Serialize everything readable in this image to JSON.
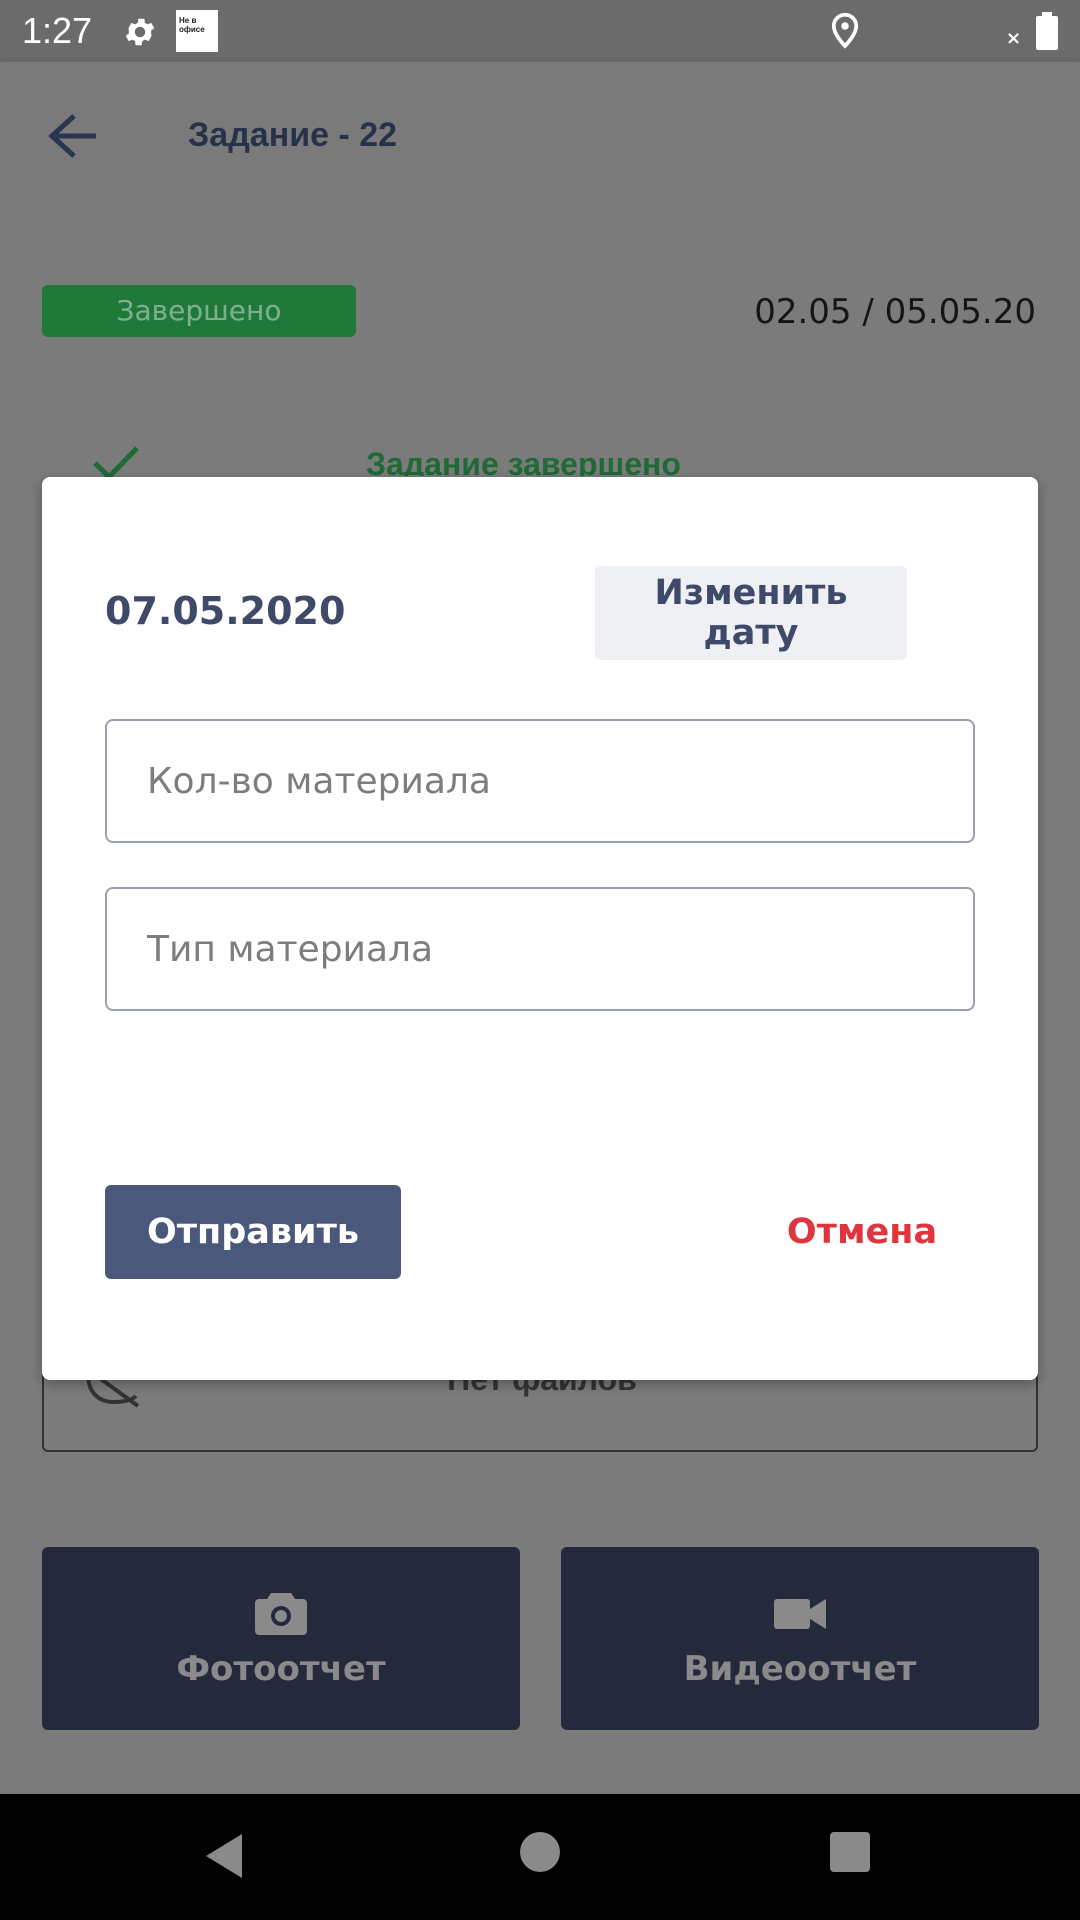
{
  "status_bar": {
    "time": "1:27",
    "office_badge": "Не в офисе"
  },
  "app_bar": {
    "title": "Задание - 22"
  },
  "task": {
    "status": "Завершено",
    "date_range": "02.05 / 05.05.20",
    "completed_label": "Задание завершено",
    "files_label": "Нет файлов"
  },
  "buttons": {
    "photo_report": "Фотоотчет",
    "video_report": "Видеоотчет"
  },
  "dialog": {
    "date": "07.05.2020",
    "change_date_label": "Изменить дату",
    "qty_placeholder": "Кол-во материала",
    "type_placeholder": "Тип материала",
    "submit_label": "Отправить",
    "cancel_label": "Отмена"
  },
  "colors": {
    "accent": "#4a587c",
    "cancel": "#e0353f",
    "status_done": "#1f7a3a",
    "report_button": "#242a3c"
  },
  "icons": [
    "settings-icon",
    "location-icon",
    "battery-icon",
    "back-arrow-icon",
    "check-icon",
    "no-files-icon",
    "camera-icon",
    "video-camera-icon"
  ]
}
